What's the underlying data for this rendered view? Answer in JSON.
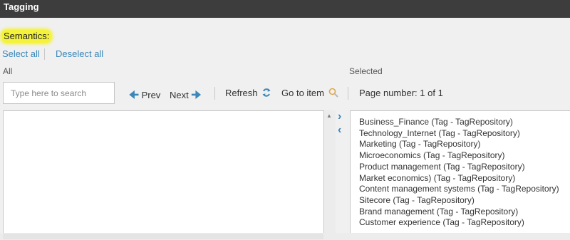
{
  "window": {
    "title": "Tagging"
  },
  "field": {
    "label": "Semantics:"
  },
  "selection": {
    "select_all": "Select all",
    "deselect_all": "Deselect all"
  },
  "columns": {
    "all": "All",
    "selected": "Selected"
  },
  "search": {
    "placeholder": "Type here to search",
    "value": ""
  },
  "toolbar": {
    "prev": "Prev",
    "next": "Next",
    "refresh": "Refresh",
    "go_to_item": "Go to item",
    "page_number": "Page number: 1 of 1"
  },
  "icons": {
    "prev": "arrow-left-icon",
    "next": "arrow-right-icon",
    "refresh": "refresh-icon",
    "go_to_item": "magnifier-icon",
    "move_right": "chevron-right-icon",
    "move_left": "chevron-left-icon"
  },
  "colors": {
    "accent": "#3a87b8",
    "titlebar": "#3d3d3d",
    "highlight": "#f4f23a",
    "search_icon": "#e0a84a"
  },
  "selected_items": [
    "Business_Finance (Tag - TagRepository)",
    "Technology_Internet (Tag - TagRepository)",
    "Marketing (Tag - TagRepository)",
    "Microeconomics (Tag - TagRepository)",
    "Product management (Tag - TagRepository)",
    "Market economics) (Tag - TagRepository)",
    "Content management systems (Tag - TagRepository)",
    "Sitecore (Tag - TagRepository)",
    "Brand management (Tag - TagRepository)",
    "Customer experience (Tag - TagRepository)"
  ]
}
